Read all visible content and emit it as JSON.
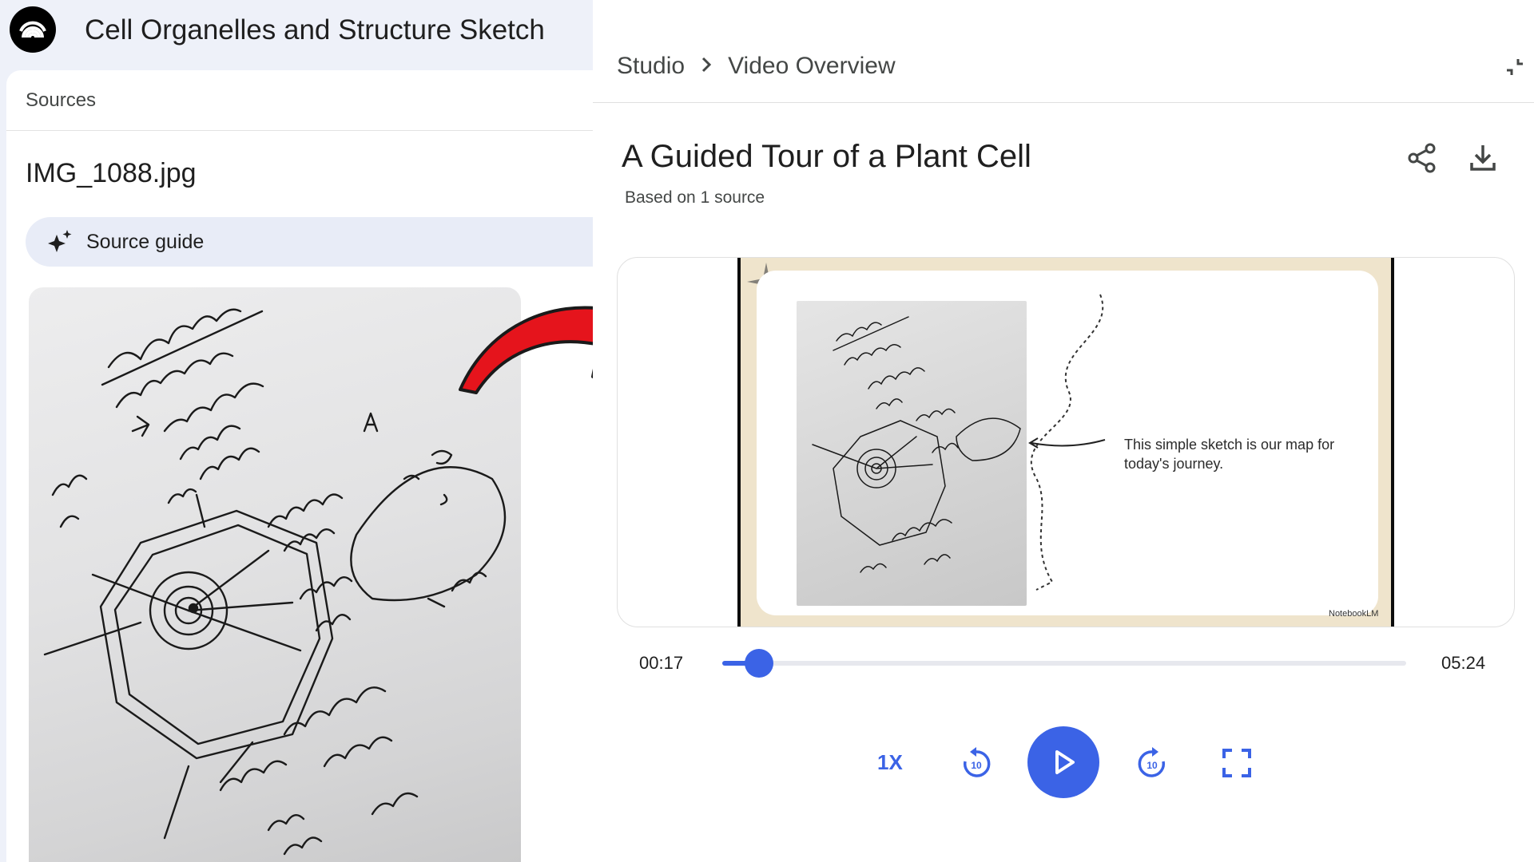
{
  "app": {
    "title": "Cell Organelles and Structure Sketch",
    "logo_icon": "notebooklm-logo-icon"
  },
  "sources": {
    "header": "Sources",
    "filename": "IMG_1088.jpg",
    "source_guide_label": "Source guide",
    "source_guide_icon": "sparkle-icon",
    "image_alt": "handwritten-plant-cell-sketch"
  },
  "arrow": {
    "color": "#e5141c",
    "icon": "curved-arrow-icon"
  },
  "studio": {
    "breadcrumb": [
      "Studio",
      "Video Overview"
    ],
    "collapse_icon": "collapse-icon",
    "video_title": "A Guided Tour of a Plant Cell",
    "video_subtitle": "Based on 1 source",
    "share_icon": "share-icon",
    "download_icon": "download-icon"
  },
  "slide": {
    "caption": "This simple sketch is our map for today's journey.",
    "brand": "NotebookLM"
  },
  "player": {
    "current_time": "00:17",
    "total_time": "05:24",
    "progress_fraction": 0.054,
    "speed_label": "1X",
    "accent": "#3b63e6",
    "rewind_icon": "rewind-10-icon",
    "play_icon": "play-icon",
    "forward_icon": "forward-10-icon",
    "fullscreen_icon": "fullscreen-icon"
  }
}
